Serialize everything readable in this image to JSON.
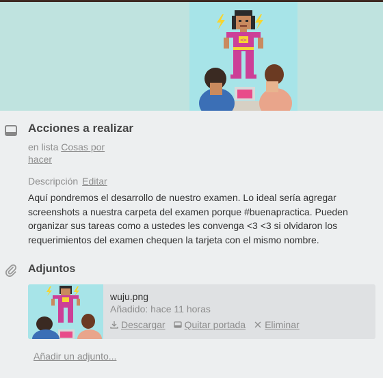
{
  "card": {
    "title": "Acciones a realizar",
    "in_list_prefix": "en lista",
    "list_name": "Cosas por hacer"
  },
  "description": {
    "label": "Descripción",
    "edit_label": "Editar",
    "text": "Aquí pondremos el desarrollo de nuestro examen. Lo ideal sería agregar screenshots a nuestra carpeta del examen porque #buenapractica. Pueden organizar sus tareas como a ustedes les convenga <3 <3 si olvidaron los requerimientos del examen chequen la tarjeta con el mismo nombre."
  },
  "attachments": {
    "title": "Adjuntos",
    "items": [
      {
        "filename": "wuju.png",
        "added": "Añadido: hace 11 horas",
        "download_label": "Descargar",
        "remove_cover_label": "Quitar portada",
        "delete_label": "Eliminar"
      }
    ],
    "add_label": "Añadir un adjunto..."
  },
  "icons": {
    "card_section": "card-window-icon",
    "attachments_section": "paperclip-icon",
    "download": "download-icon",
    "cover": "cover-icon",
    "delete": "close-icon"
  },
  "colors": {
    "background": "#edeff0",
    "cover_band": "#bfe3df",
    "illustration_bg": "#a7e4e8",
    "heroine_suit": "#cc3f97",
    "muted_text": "#8c8c8c"
  }
}
